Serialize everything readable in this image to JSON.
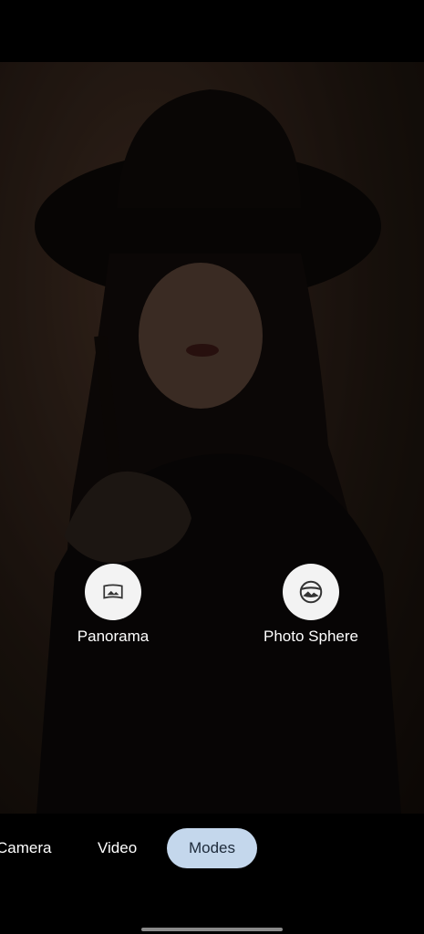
{
  "modes": {
    "options": [
      {
        "label": "Panorama",
        "icon": "panorama-icon"
      },
      {
        "label": "Photo Sphere",
        "icon": "photo-sphere-icon"
      }
    ]
  },
  "mode_bar": {
    "tabs": [
      {
        "label": "Camera"
      },
      {
        "label": "Video"
      },
      {
        "label": "Modes",
        "selected": true
      }
    ]
  },
  "colors": {
    "selected_tab_bg": "#c4d7ec",
    "option_circle_bg": "#f3f3f3"
  }
}
